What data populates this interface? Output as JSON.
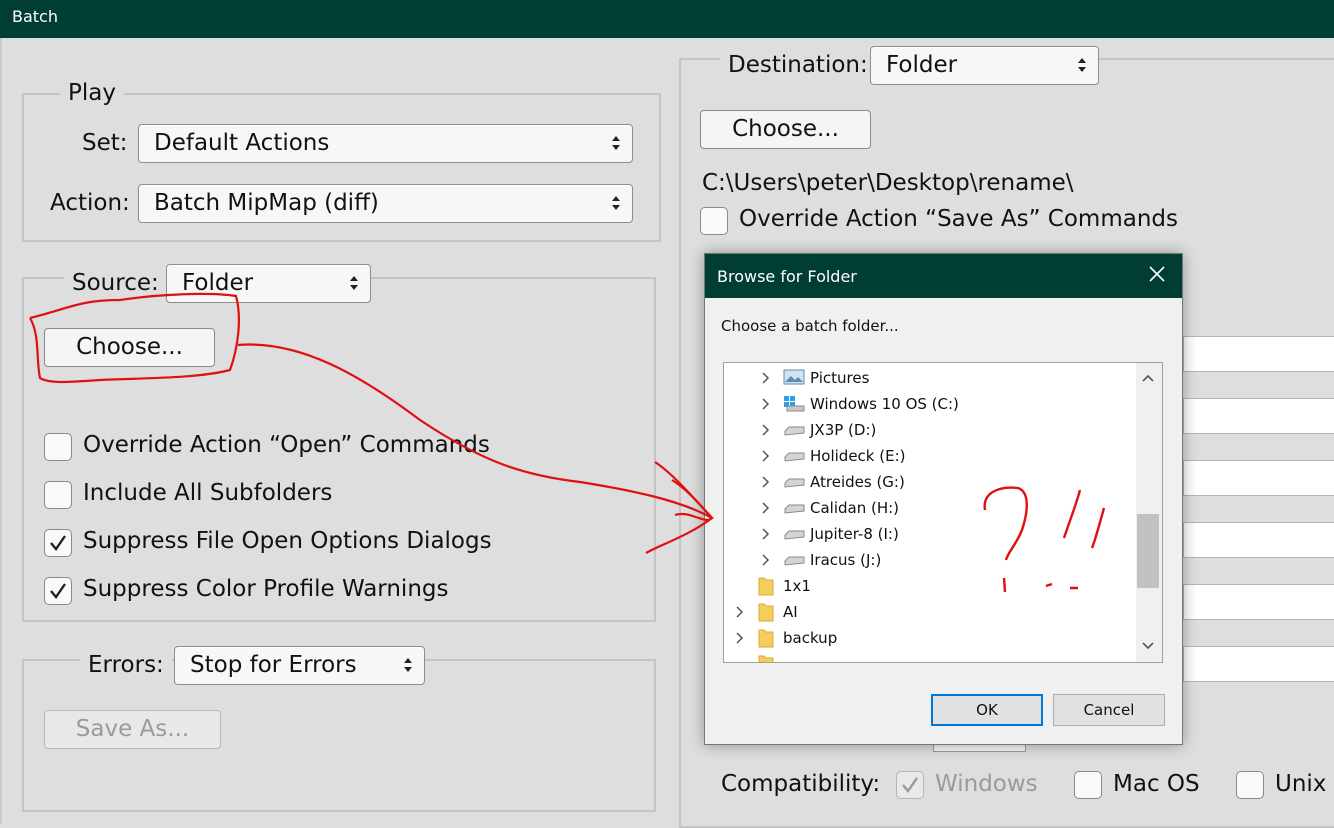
{
  "window": {
    "title": "Batch"
  },
  "play": {
    "legend": "Play",
    "set_label": "Set:",
    "set_value": "Default Actions",
    "action_label": "Action:",
    "action_value": "Batch MipMap (diff)"
  },
  "source": {
    "label": "Source:",
    "value": "Folder",
    "choose_label": "Choose...",
    "checkboxes": [
      {
        "label": "Override Action “Open” Commands",
        "checked": false
      },
      {
        "label": "Include All Subfolders",
        "checked": false
      },
      {
        "label": "Suppress File Open Options Dialogs",
        "checked": true
      },
      {
        "label": "Suppress Color Profile Warnings",
        "checked": true
      }
    ]
  },
  "errors": {
    "label": "Errors:",
    "value": "Stop for Errors",
    "save_as_label": "Save As..."
  },
  "destination": {
    "label": "Destination:",
    "value": "Folder",
    "choose_label": "Choose...",
    "path": "C:\\Users\\peter\\Desktop\\rename\\",
    "override_label": "Override Action “Save As” Commands",
    "override_checked": false
  },
  "compatibility": {
    "label": "Compatibility:",
    "options": [
      {
        "label": "Windows",
        "checked": true,
        "disabled": true
      },
      {
        "label": "Mac OS",
        "checked": false,
        "disabled": false
      },
      {
        "label": "Unix",
        "checked": false,
        "disabled": false
      }
    ]
  },
  "dialog": {
    "title": "Browse for Folder",
    "prompt": "Choose a batch folder...",
    "tree_items": [
      {
        "label": "Pictures",
        "icon": "pictures-icon"
      },
      {
        "label": "Windows 10 OS (C:)",
        "icon": "windows-drive-icon"
      },
      {
        "label": "JX3P (D:)",
        "icon": "drive-icon"
      },
      {
        "label": "Holideck (E:)",
        "icon": "drive-icon"
      },
      {
        "label": "Atreides (G:)",
        "icon": "drive-icon"
      },
      {
        "label": "Calidan (H:)",
        "icon": "drive-icon"
      },
      {
        "label": "Jupiter-8 (I:)",
        "icon": "drive-icon"
      },
      {
        "label": "Iracus (J:)",
        "icon": "drive-icon"
      },
      {
        "label": "1x1",
        "icon": "folder-icon"
      },
      {
        "label": "AI",
        "icon": "folder-icon"
      },
      {
        "label": "backup",
        "icon": "folder-icon"
      }
    ],
    "ok_label": "OK",
    "cancel_label": "Cancel"
  },
  "colors": {
    "titlebar": "#003d33",
    "annotation": "#e01010",
    "dialog_focus": "#0078d7"
  }
}
